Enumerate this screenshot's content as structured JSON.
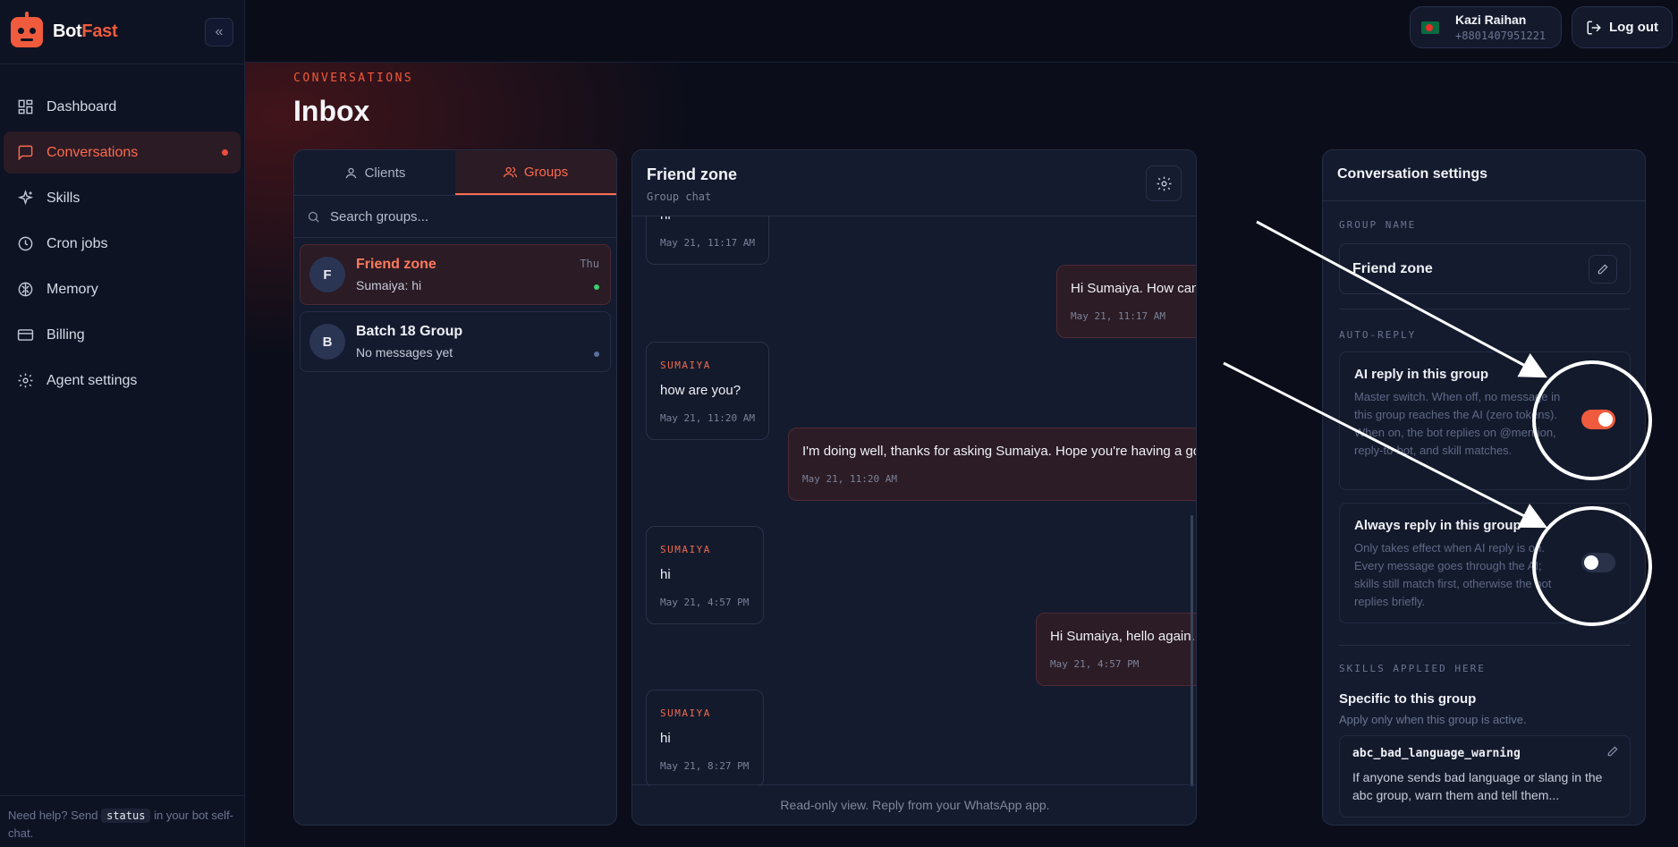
{
  "brand": {
    "name_part1": "Bot",
    "name_part2": "Fast",
    "accent": "#ef5b3c"
  },
  "sidebar": {
    "items": [
      {
        "label": "Dashboard",
        "icon": "dashboard-icon",
        "active": false
      },
      {
        "label": "Conversations",
        "icon": "chat-icon",
        "active": true
      },
      {
        "label": "Skills",
        "icon": "sparkle-icon",
        "active": false
      },
      {
        "label": "Cron jobs",
        "icon": "clock-icon",
        "active": false
      },
      {
        "label": "Memory",
        "icon": "brain-icon",
        "active": false
      },
      {
        "label": "Billing",
        "icon": "card-icon",
        "active": false
      },
      {
        "label": "Agent settings",
        "icon": "gear-icon",
        "active": false
      }
    ],
    "help_prefix": "Need help? Send",
    "help_code": "status",
    "help_suffix": "in your bot self-chat."
  },
  "topbar": {
    "user_name": "Kazi Raihan",
    "user_phone": "+8801407951221",
    "logout_label": "Log out"
  },
  "page": {
    "eyebrow": "CONVERSATIONS",
    "title": "Inbox"
  },
  "list": {
    "tabs": [
      {
        "label": "Clients",
        "icon": "user-icon",
        "active": false
      },
      {
        "label": "Groups",
        "icon": "users-icon",
        "active": true
      }
    ],
    "search_placeholder": "Search groups...",
    "items": [
      {
        "initial": "F",
        "name": "Friend zone",
        "preview": "Sumaiya: hi",
        "time": "Thu",
        "dot_color": "#3ecf6e",
        "active": true
      },
      {
        "initial": "B",
        "name": "Batch 18 Group",
        "preview": "No messages yet",
        "time": "",
        "dot_color": "#5a6f9e",
        "active": false
      }
    ]
  },
  "chat": {
    "title": "Friend zone",
    "subtitle": "Group chat",
    "messages": [
      {
        "dir": "in",
        "sender": "",
        "text": "hi",
        "time": "May 21, 11:17 AM"
      },
      {
        "dir": "out",
        "sender": "",
        "text": "Hi Sumaiya. How can I help you?",
        "time": "May 21, 11:17 AM"
      },
      {
        "dir": "in",
        "sender": "SUMAIYA",
        "text": "how are you?",
        "time": "May 21, 11:20 AM"
      },
      {
        "dir": "out",
        "sender": "",
        "text": "I'm doing well, thanks for asking Sumaiya. Hope you're having a good day too.",
        "time": "May 21, 11:20 AM"
      },
      {
        "dir": "in",
        "sender": "SUMAIYA",
        "text": "hi",
        "time": "May 21, 4:57 PM"
      },
      {
        "dir": "out",
        "sender": "",
        "text": "Hi Sumaiya, hello again. What's up?",
        "time": "May 21, 4:57 PM"
      },
      {
        "dir": "in",
        "sender": "SUMAIYA",
        "text": "hi",
        "time": "May 21, 8:27 PM"
      }
    ],
    "footer": "Read-only view. Reply from your WhatsApp app."
  },
  "settings": {
    "title": "Conversation settings",
    "group_name_label": "GROUP NAME",
    "group_name": "Friend zone",
    "auto_reply_label": "AUTO-REPLY",
    "ai_reply": {
      "title": "AI reply in this group",
      "desc": "Master switch. When off, no message in this group reaches the AI (zero tokens). When on, the bot replies on @mention, reply-to-bot, and skill matches.",
      "enabled": true
    },
    "always_reply": {
      "title": "Always reply in this group",
      "desc": "Only takes effect when AI reply is on. Every message goes through the AI; skills still match first, otherwise the bot replies briefly.",
      "enabled": false
    },
    "skills_label": "SKILLS APPLIED HERE",
    "skills_heading": "Specific to this group",
    "skills_sub": "Apply only when this group is active.",
    "skill": {
      "name": "abc_bad_language_warning",
      "desc": "If anyone sends bad language or slang in the abc group, warn them and tell them..."
    }
  }
}
